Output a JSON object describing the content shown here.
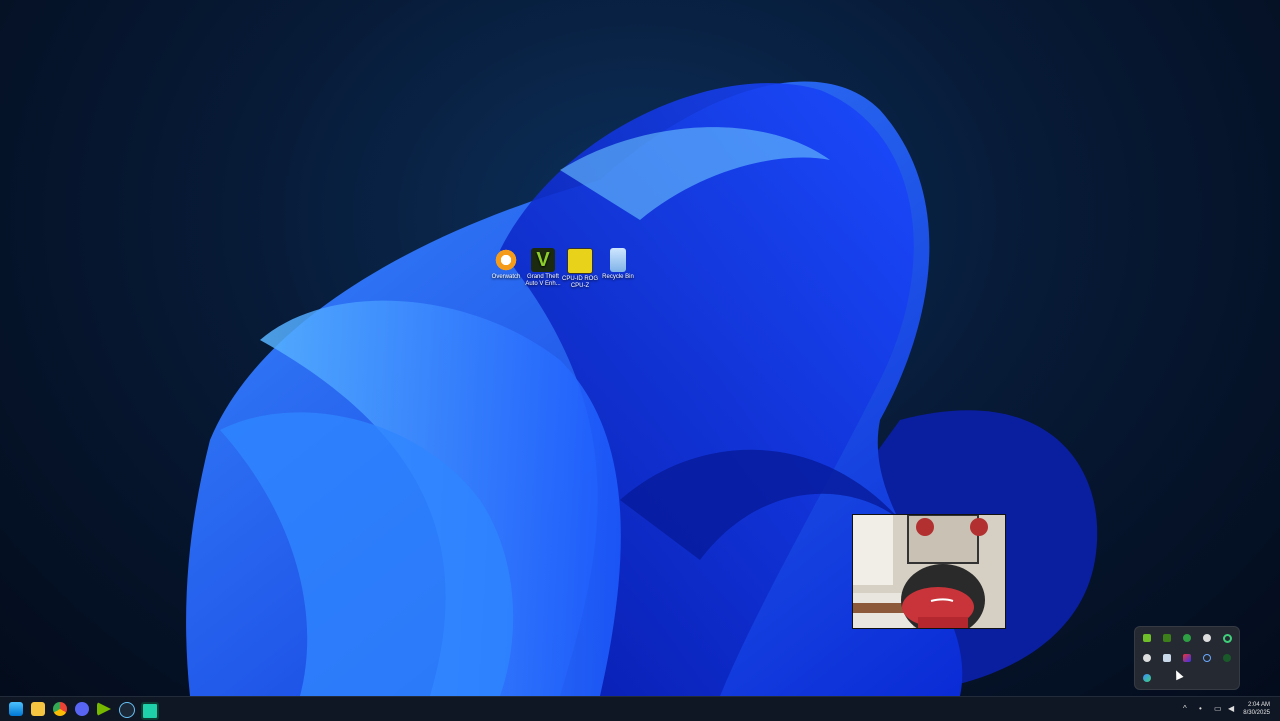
{
  "desktop": {
    "icons": [
      {
        "label": "Overwatch",
        "icon": "overwatch-icon"
      },
      {
        "label": "Grand Theft Auto V Enh...",
        "icon": "gta-v-icon"
      },
      {
        "label": "CPU-ID ROG CPU-Z",
        "icon": "cpu-z-icon"
      },
      {
        "label": "Recycle Bin",
        "icon": "recycle-bin-icon"
      }
    ]
  },
  "taskbar": {
    "pinned": [
      "start-icon",
      "file-explorer-icon",
      "chrome-icon",
      "discord-icon",
      "nvidia-icon",
      "steam-icon",
      "app-icon"
    ],
    "clock": {
      "time": "2:04 AM",
      "date": "8/30/2025"
    }
  },
  "tray_popup": {
    "icons": [
      "nvidia-icon",
      "nvidia-share-icon",
      "xbox-icon",
      "app-icon",
      "circle-icon",
      "gear-icon",
      "steam-icon",
      "color-icon",
      "ring-icon",
      "green-icon",
      "network-icon"
    ]
  },
  "colors": {
    "accent": "#1f6bff",
    "taskbar": "#0f1724"
  }
}
